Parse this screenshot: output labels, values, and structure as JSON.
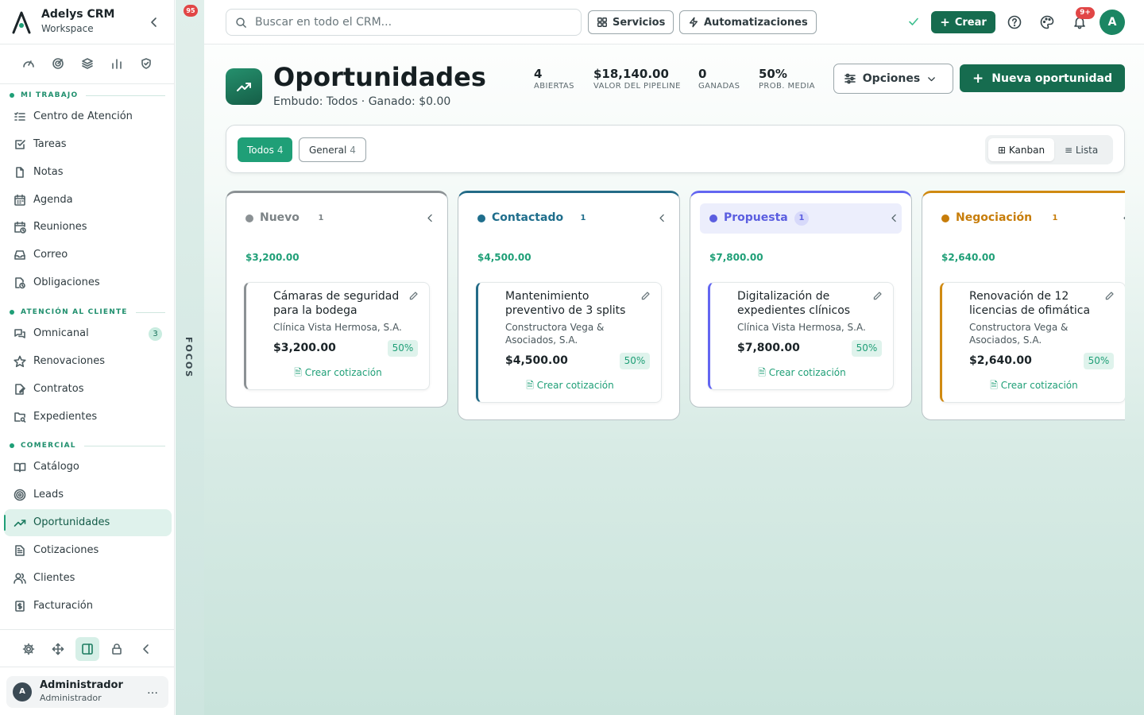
{
  "sidebar": {
    "brand_name": "Adelys CRM",
    "brand_sub": "Workspace",
    "quick_icons": [
      "gauge-icon",
      "focus-icon",
      "layers-icon",
      "chart-icon",
      "shield-icon"
    ],
    "sections": [
      {
        "label": "MI TRABAJO"
      },
      {
        "label": "ATENCIÓN AL CLIENTE"
      },
      {
        "label": "COMERCIAL"
      }
    ],
    "items": [
      {
        "label": "Centro de Atención"
      },
      {
        "label": "Tareas"
      },
      {
        "label": "Notas"
      },
      {
        "label": "Agenda"
      },
      {
        "label": "Reuniones"
      },
      {
        "label": "Correo"
      },
      {
        "label": "Obligaciones"
      },
      {
        "label": "Omnicanal",
        "badge": "3"
      },
      {
        "label": "Renovaciones"
      },
      {
        "label": "Contratos"
      },
      {
        "label": "Expedientes"
      },
      {
        "label": "Catálogo"
      },
      {
        "label": "Leads"
      },
      {
        "label": "Oportunidades",
        "active": true
      },
      {
        "label": "Cotizaciones"
      },
      {
        "label": "Clientes"
      },
      {
        "label": "Facturación"
      }
    ],
    "user": {
      "avatar": "A",
      "name": "Administrador",
      "role": "Administrador",
      "more": "…"
    }
  },
  "focos": {
    "badge": "95",
    "label": "FOCOS"
  },
  "topbar": {
    "search_placeholder": "Buscar en todo el CRM...",
    "services_label": "Servicios",
    "automations_label": "Automatizaciones",
    "create_label": "Crear",
    "notifications_badge": "9+",
    "avatar": "A"
  },
  "header": {
    "title": "Oportunidades",
    "subtitle": "Embudo: Todos · Ganado: $0.00",
    "stats": [
      {
        "value": "4",
        "label": "ABIERTAS"
      },
      {
        "value": "$18,140.00",
        "label": "VALOR DEL PIPELINE"
      },
      {
        "value": "0",
        "label": "GANADAS"
      },
      {
        "value": "50%",
        "label": "PROB. MEDIA"
      }
    ],
    "options_label": "Opciones",
    "new_label": "Nueva oportunidad"
  },
  "filters": {
    "pills": [
      {
        "label": "Todos",
        "count": "4"
      },
      {
        "label": "General",
        "count": "4"
      }
    ],
    "view_kanban": "⊞ Kanban",
    "view_list": "≡ Lista"
  },
  "board": {
    "columns": [
      {
        "name": "Nuevo",
        "count": "1",
        "total": "$3,200.00",
        "color": "#8b9194",
        "top_color": "#8b9194",
        "cards": [
          {
            "title": "Cámaras de seguridad para la bodega",
            "company": "Clínica Vista Hermosa, S.A.",
            "amount": "$3,200.00",
            "prob": "50%",
            "action": "Crear cotización"
          }
        ]
      },
      {
        "name": "Contactado",
        "count": "1",
        "total": "$4,500.00",
        "color": "#1f6e8c",
        "top_color": "#236b87",
        "cards": [
          {
            "title": "Mantenimiento preventivo de 3 splits",
            "company": "Constructora Vega & Asociados, S.A.",
            "amount": "$4,500.00",
            "prob": "50%",
            "action": "Crear cotización"
          }
        ]
      },
      {
        "name": "Propuesta",
        "count": "1",
        "total": "$7,800.00",
        "color": "#5b5ee0",
        "top_color": "#6366f1",
        "cards": [
          {
            "title": "Digitalización de expedientes clínicos",
            "company": "Clínica Vista Hermosa, S.A.",
            "amount": "$7,800.00",
            "prob": "50%",
            "action": "Crear cotización"
          }
        ]
      },
      {
        "name": "Negociación",
        "count": "1",
        "total": "$2,640.00",
        "color": "#c77d0a",
        "top_color": "#d08a12",
        "cards": [
          {
            "title": "Renovación de 12 licencias de ofimática",
            "company": "Constructora Vega & Asociados, S.A.",
            "amount": "$2,640.00",
            "prob": "50%",
            "action": "Crear cotización"
          }
        ]
      }
    ]
  }
}
